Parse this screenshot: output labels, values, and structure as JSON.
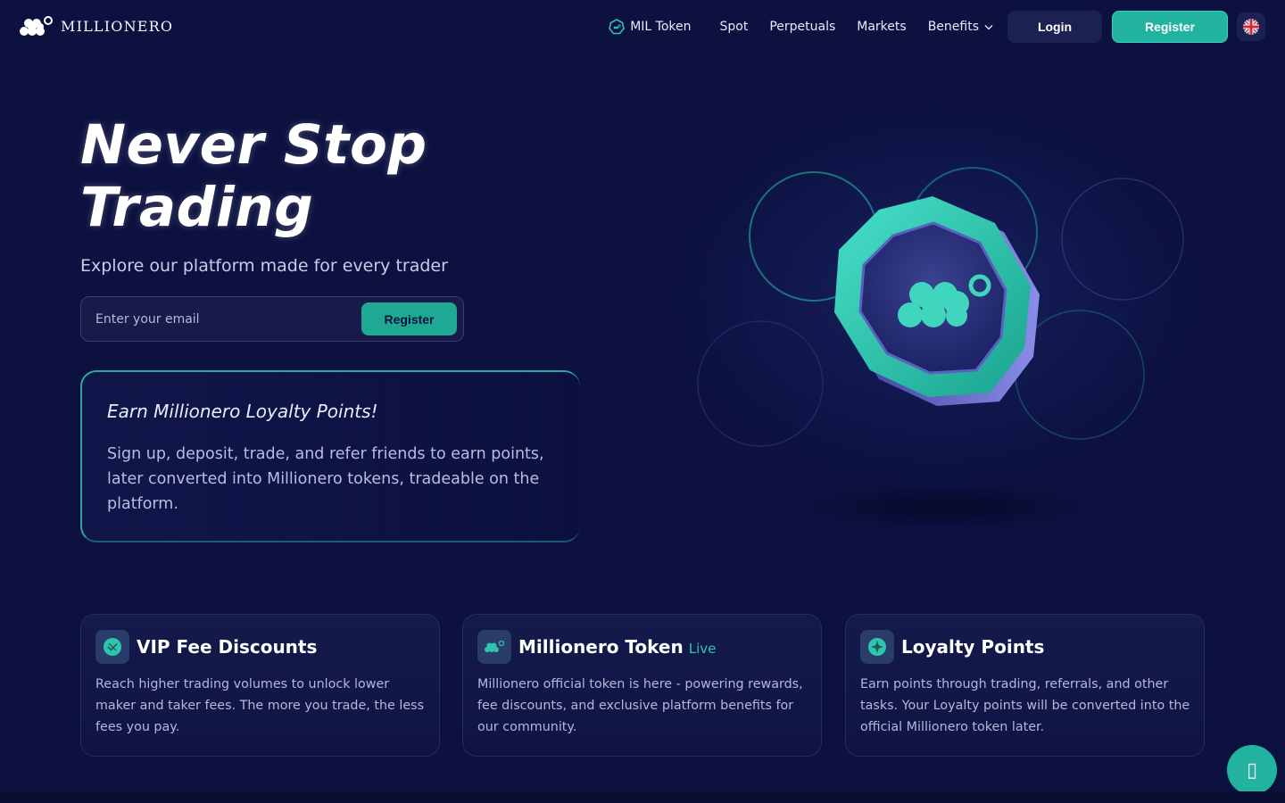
{
  "brand": {
    "name": "MILLIONERO",
    "accent": "#22b3a0",
    "background": "#0c1140"
  },
  "nav": {
    "items": [
      {
        "label": "MIL Token",
        "icon": "mil-token-icon"
      },
      {
        "label": "Spot"
      },
      {
        "label": "Perpetuals"
      },
      {
        "label": "Markets"
      },
      {
        "label": "Benefits",
        "icon": "chevron-down-icon"
      }
    ],
    "login_label": "Login",
    "register_label": "Register",
    "language_icon": "uk-flag-icon"
  },
  "hero": {
    "title": "Never Stop Trading",
    "subtitle": "Explore our platform made for every trader",
    "email_placeholder": "Enter your email",
    "email_value": "",
    "register_label": "Register"
  },
  "loyalty": {
    "title": "Earn Millionero Loyalty Points!",
    "text": "Sign up, deposit, trade, and refer friends to earn points, later converted into Millionero tokens, tradeable on the platform."
  },
  "features": [
    {
      "icon": "vip-badge-icon",
      "title": "VIP Fee Discounts",
      "badge": "",
      "description": "Reach higher trading volumes to unlock lower maker and taker fees. The more you trade, the less fees you pay."
    },
    {
      "icon": "millionero-logo-icon",
      "title": "Millionero Token",
      "badge": "Live",
      "description": "Millionero official token is here - powering rewards, fee discounts, and exclusive platform benefits for our community."
    },
    {
      "icon": "loyalty-star-icon",
      "title": "Loyalty Points",
      "badge": "",
      "description": "Earn points through trading, referrals, and other tasks. Your Loyalty points will be converted into the official Millionero token later."
    }
  ],
  "chat": {
    "icon": "chat-icon",
    "glyph": "▯"
  }
}
